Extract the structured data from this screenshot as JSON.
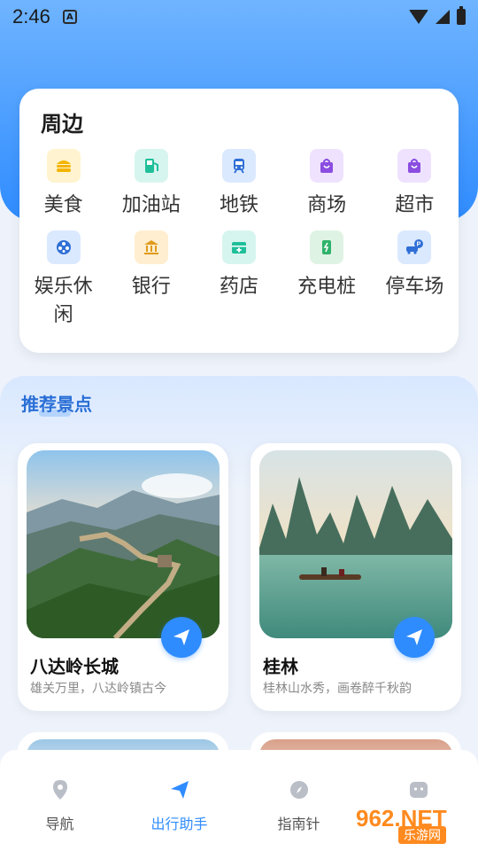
{
  "status_bar": {
    "time": "2:46",
    "app_icon_letter": "A"
  },
  "nearby": {
    "title": "周边",
    "items": [
      {
        "label": "美食",
        "icon": "burger-icon",
        "bg": "#fff4cf",
        "color": "#f4b400"
      },
      {
        "label": "加油站",
        "icon": "gas-station-icon",
        "bg": "#d7f5ef",
        "color": "#1fbf9a"
      },
      {
        "label": "地铁",
        "icon": "metro-icon",
        "bg": "#dbe9ff",
        "color": "#2f6fd6"
      },
      {
        "label": "商场",
        "icon": "shopping-bag-icon",
        "bg": "#efe2ff",
        "color": "#8a4de0"
      },
      {
        "label": "超市",
        "icon": "shopping-bag-icon",
        "bg": "#efe2ff",
        "color": "#8a4de0"
      },
      {
        "label": "娱乐休闲",
        "icon": "film-reel-icon",
        "bg": "#dbe9ff",
        "color": "#2f6fd6"
      },
      {
        "label": "银行",
        "icon": "bank-icon",
        "bg": "#ffeecf",
        "color": "#e09a1b"
      },
      {
        "label": "药店",
        "icon": "medicine-box-icon",
        "bg": "#d7f5ef",
        "color": "#1fbf9a"
      },
      {
        "label": "充电桩",
        "icon": "charging-station-icon",
        "bg": "#dff3e4",
        "color": "#2fb26a"
      },
      {
        "label": "停车场",
        "icon": "parking-icon",
        "bg": "#dbe9ff",
        "color": "#2f6fd6"
      }
    ]
  },
  "recommend": {
    "title": "推荐景点",
    "spots": [
      {
        "name": "八达岭长城",
        "desc": "雄关万里，八达岭镇古今",
        "image": "great-wall-image"
      },
      {
        "name": "桂林",
        "desc": "桂林山水秀，画卷醉千秋韵",
        "image": "guilin-river-image"
      }
    ]
  },
  "bottom_nav": {
    "items": [
      {
        "label": "导航",
        "icon": "location-pin-icon",
        "active": false
      },
      {
        "label": "出行助手",
        "icon": "paper-plane-icon",
        "active": true
      },
      {
        "label": "指南针",
        "icon": "compass-icon",
        "active": false
      },
      {
        "label": "",
        "icon": "robot-face-icon",
        "active": false
      }
    ]
  },
  "watermark": {
    "number": "962.NET",
    "sub": "乐游网"
  },
  "colors": {
    "primary": "#2f8cff",
    "header_top": "#6fb4ff"
  }
}
